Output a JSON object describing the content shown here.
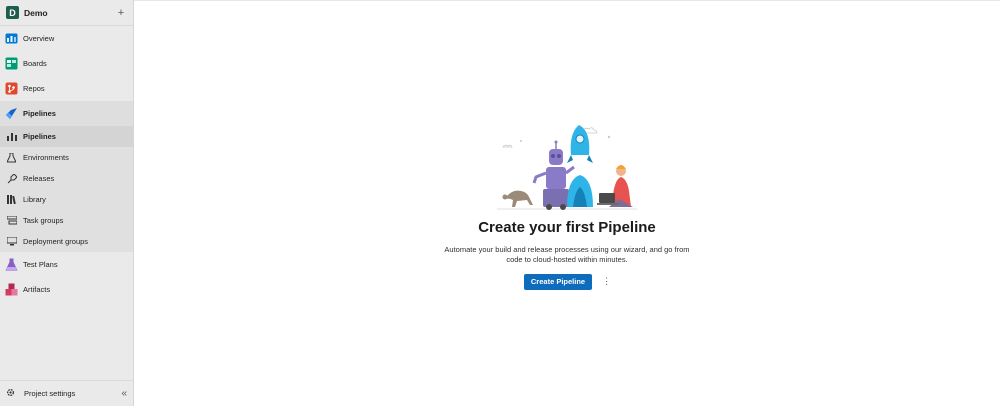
{
  "project": {
    "initial": "D",
    "name": "Demo",
    "add_icon": "plus-icon"
  },
  "nav": {
    "overview": {
      "label": "Overview",
      "icon": "overview-icon",
      "color": "#0078d4"
    },
    "boards": {
      "label": "Boards",
      "icon": "boards-icon",
      "color": "#009a74"
    },
    "repos": {
      "label": "Repos",
      "icon": "repos-icon",
      "color": "#e1482e"
    },
    "pipelines": {
      "label": "Pipelines",
      "icon": "pipelines-icon",
      "color": "#1463cf"
    },
    "test_plans": {
      "label": "Test Plans",
      "icon": "test-plans-icon",
      "color": "#8661c5"
    },
    "artifacts": {
      "label": "Artifacts",
      "icon": "artifacts-icon",
      "color": "#d13d63"
    }
  },
  "pipelines_sub": [
    {
      "label": "Pipelines",
      "icon": "pipeline-bars-icon"
    },
    {
      "label": "Environments",
      "icon": "environment-icon"
    },
    {
      "label": "Releases",
      "icon": "releases-icon"
    },
    {
      "label": "Library",
      "icon": "library-icon"
    },
    {
      "label": "Task groups",
      "icon": "task-groups-icon"
    },
    {
      "label": "Deployment groups",
      "icon": "deployment-groups-icon"
    }
  ],
  "footer": {
    "label": "Project settings",
    "icon": "gear-icon",
    "collapse_icon": "double-chevron-left-icon"
  },
  "empty_state": {
    "title": "Create your first Pipeline",
    "description": "Automate your build and release processes using our wizard, and go from code to cloud-hosted within minutes.",
    "primary_button": "Create Pipeline",
    "more_icon": "more-vertical-icon"
  },
  "accent_color": "#0f6cbd"
}
